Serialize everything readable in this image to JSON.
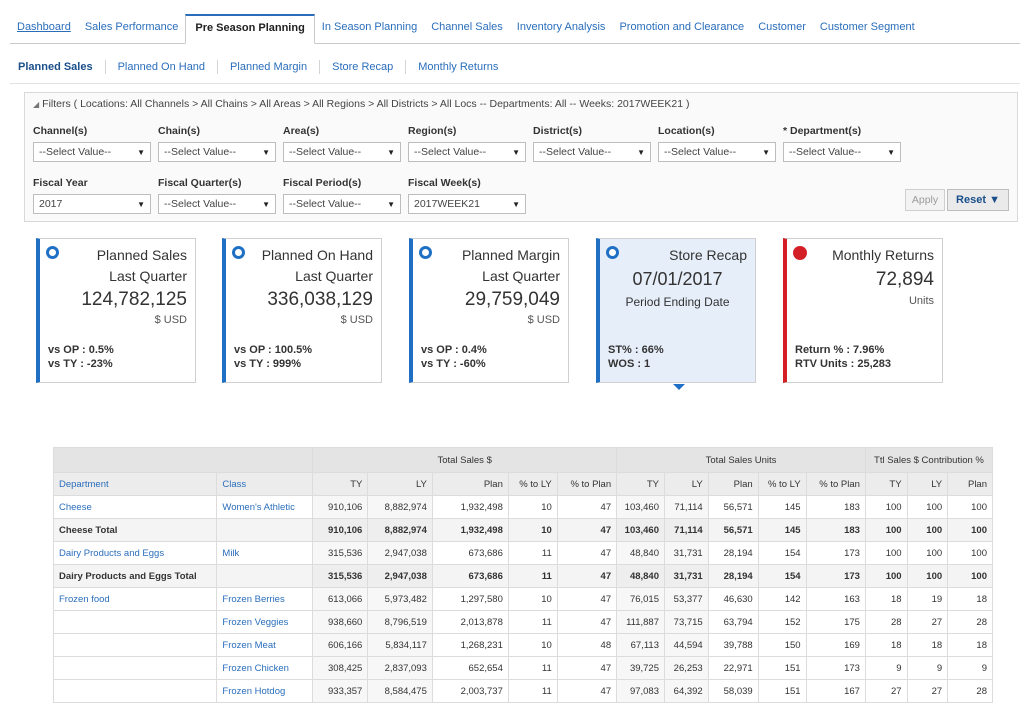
{
  "top_tabs": [
    "Dashboard",
    "Sales Performance",
    "Pre Season Planning",
    "In Season Planning",
    "Channel Sales",
    "Inventory Analysis",
    "Promotion and Clearance",
    "Customer",
    "Customer Segment"
  ],
  "sub_tabs": [
    "Planned Sales",
    "Planned On Hand",
    "Planned Margin",
    "Store Recap",
    "Monthly Returns"
  ],
  "filters": {
    "summary": "Filters ( Locations: All Channels > All Chains > All Areas > All Regions > All Districts > All Locs -- Departments: All -- Weeks: 2017WEEK21 )",
    "row1": [
      {
        "label": "Channel(s)",
        "value": "--Select Value--"
      },
      {
        "label": "Chain(s)",
        "value": "--Select Value--"
      },
      {
        "label": "Area(s)",
        "value": "--Select Value--"
      },
      {
        "label": "Region(s)",
        "value": "--Select Value--"
      },
      {
        "label": "District(s)",
        "value": "--Select Value--"
      },
      {
        "label": "Location(s)",
        "value": "--Select Value--"
      },
      {
        "label": "* Department(s)",
        "value": "--Select Value--"
      }
    ],
    "row2": [
      {
        "label": "Fiscal Year",
        "value": "2017"
      },
      {
        "label": "Fiscal Quarter(s)",
        "value": "--Select Value--"
      },
      {
        "label": "Fiscal Period(s)",
        "value": "--Select Value--"
      },
      {
        "label": "Fiscal Week(s)",
        "value": "2017WEEK21"
      }
    ],
    "apply_label": "Apply",
    "reset_label": "Reset ▼"
  },
  "cards": {
    "planned_sales": {
      "title": "Planned Sales",
      "sub": "Last Quarter",
      "value": "124,782,125",
      "unit": "$ USD",
      "m1": "vs OP : 0.5%",
      "m2": "vs TY : -23%"
    },
    "planned_on_hand": {
      "title": "Planned On Hand",
      "sub": "Last Quarter",
      "value": "336,038,129",
      "unit": "$ USD",
      "m1": "vs OP : 100.5%",
      "m2": "vs TY : 999%"
    },
    "planned_margin": {
      "title": "Planned Margin",
      "sub": "Last Quarter",
      "value": "29,759,049",
      "unit": "$ USD",
      "m1": "vs OP : 0.4%",
      "m2": "vs TY : -60%"
    },
    "store_recap": {
      "title": "Store Recap",
      "date": "07/01/2017",
      "sub": "Period Ending Date",
      "m1": "ST% : 66%",
      "m2": "WOS : 1"
    },
    "monthly_returns": {
      "title": "Monthly Returns",
      "value": "72,894",
      "unit": "Units",
      "m1": "Return % : 7.96%",
      "m2": "RTV Units : 25,283"
    }
  },
  "table": {
    "group_headers": [
      "Total Sales $",
      "Total Sales Units",
      "Ttl Sales $ Contribution %"
    ],
    "columns": [
      "Department",
      "Class",
      "TY",
      "LY",
      "Plan",
      "% to LY",
      "% to Plan",
      "TY",
      "LY",
      "Plan",
      "% to LY",
      "% to Plan",
      "TY",
      "LY",
      "Plan"
    ],
    "rows": [
      {
        "dept": "Cheese",
        "cls": "Women's Athletic",
        "total": false,
        "vals": [
          "910,106",
          "8,882,974",
          "1,932,498",
          "10",
          "47",
          "103,460",
          "71,114",
          "56,571",
          "145",
          "183",
          "100",
          "100",
          "100"
        ]
      },
      {
        "dept": "Cheese Total",
        "cls": "",
        "total": true,
        "vals": [
          "910,106",
          "8,882,974",
          "1,932,498",
          "10",
          "47",
          "103,460",
          "71,114",
          "56,571",
          "145",
          "183",
          "100",
          "100",
          "100"
        ]
      },
      {
        "dept": "Dairy Products and Eggs",
        "cls": "Milk",
        "total": false,
        "vals": [
          "315,536",
          "2,947,038",
          "673,686",
          "11",
          "47",
          "48,840",
          "31,731",
          "28,194",
          "154",
          "173",
          "100",
          "100",
          "100"
        ]
      },
      {
        "dept": "Dairy Products and Eggs Total",
        "cls": "",
        "total": true,
        "vals": [
          "315,536",
          "2,947,038",
          "673,686",
          "11",
          "47",
          "48,840",
          "31,731",
          "28,194",
          "154",
          "173",
          "100",
          "100",
          "100"
        ]
      },
      {
        "dept": "Frozen food",
        "cls": "Frozen Berries",
        "total": false,
        "vals": [
          "613,066",
          "5,973,482",
          "1,297,580",
          "10",
          "47",
          "76,015",
          "53,377",
          "46,630",
          "142",
          "163",
          "18",
          "19",
          "18"
        ]
      },
      {
        "dept": "",
        "cls": "Frozen Veggies",
        "total": false,
        "vals": [
          "938,660",
          "8,796,519",
          "2,013,878",
          "11",
          "47",
          "111,887",
          "73,715",
          "63,794",
          "152",
          "175",
          "28",
          "27",
          "28"
        ]
      },
      {
        "dept": "",
        "cls": "Frozen Meat",
        "total": false,
        "vals": [
          "606,166",
          "5,834,117",
          "1,268,231",
          "10",
          "48",
          "67,113",
          "44,594",
          "39,788",
          "150",
          "169",
          "18",
          "18",
          "18"
        ]
      },
      {
        "dept": "",
        "cls": "Frozen Chicken",
        "total": false,
        "vals": [
          "308,425",
          "2,837,093",
          "652,654",
          "11",
          "47",
          "39,725",
          "26,253",
          "22,971",
          "151",
          "173",
          "9",
          "9",
          "9"
        ]
      },
      {
        "dept": "",
        "cls": "Frozen Hotdog",
        "total": false,
        "vals": [
          "933,357",
          "8,584,475",
          "2,003,737",
          "11",
          "47",
          "97,083",
          "64,392",
          "58,039",
          "151",
          "167",
          "27",
          "27",
          "28"
        ]
      }
    ]
  }
}
